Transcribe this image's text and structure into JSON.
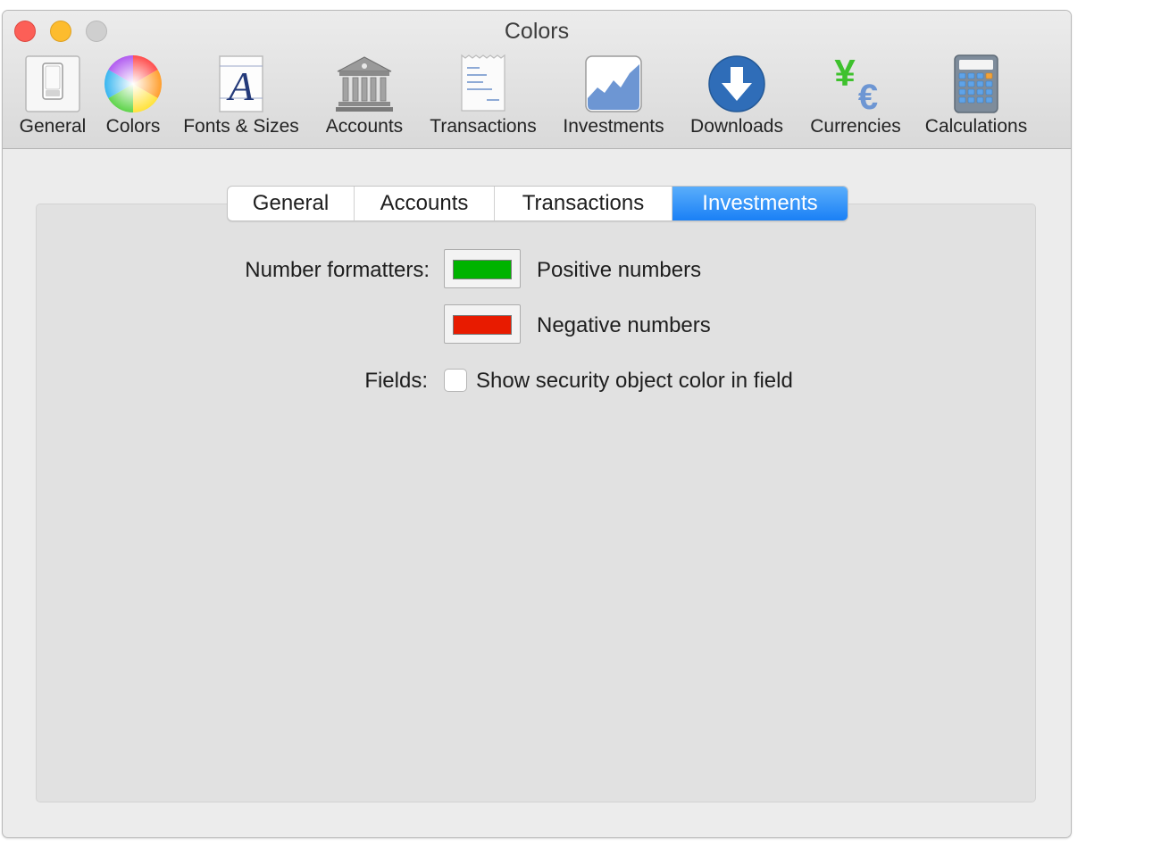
{
  "window": {
    "title": "Colors"
  },
  "toolbar": {
    "items": [
      {
        "label": "General",
        "icon": "general-switch-icon"
      },
      {
        "label": "Colors",
        "icon": "color-wheel-icon"
      },
      {
        "label": "Fonts & Sizes",
        "icon": "font-icon"
      },
      {
        "label": "Accounts",
        "icon": "bank-icon"
      },
      {
        "label": "Transactions",
        "icon": "receipt-icon"
      },
      {
        "label": "Investments",
        "icon": "chart-icon"
      },
      {
        "label": "Downloads",
        "icon": "download-icon"
      },
      {
        "label": "Currencies",
        "icon": "currency-icon"
      },
      {
        "label": "Calculations",
        "icon": "calculator-icon"
      }
    ],
    "selected": "Colors"
  },
  "tabs": {
    "items": [
      {
        "label": "General"
      },
      {
        "label": "Accounts"
      },
      {
        "label": "Transactions"
      },
      {
        "label": "Investments"
      }
    ],
    "selected": "Investments"
  },
  "form": {
    "number_formatters_label": "Number formatters:",
    "positive_label": "Positive numbers",
    "positive_color": "#00b300",
    "negative_label": "Negative numbers",
    "negative_color": "#e81b00",
    "fields_label": "Fields:",
    "security_color_label": "Show security object color in field",
    "security_color_checked": false
  },
  "colors": {
    "accent": "#1a80f6",
    "window_background": "#ececec",
    "panel_background": "#e1e1e1"
  }
}
